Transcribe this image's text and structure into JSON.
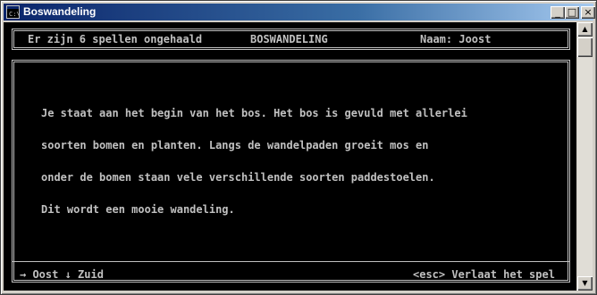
{
  "window": {
    "title": "Boswandeling",
    "controls": {
      "minimize": "_",
      "maximize": "□",
      "close": "×"
    }
  },
  "header": {
    "games_fetched": "Er zijn 6 spellen ongehaald",
    "game_title": "BOSWANDELING",
    "player_name": "Naam: Joost"
  },
  "story": {
    "lines": [
      "Je staat aan het begin van het bos. Het bos is gevuld met allerlei",
      "soorten bomen en planten. Langs de wandelpaden groeit mos en",
      "onder de bomen staan vele verschillende soorten paddestoelen.",
      "Dit wordt een mooie wandeling."
    ]
  },
  "footer": {
    "directions": "→ Oost ↓ Zuid",
    "quit_hint": "<esc> Verlaat het spel"
  },
  "scrollbar": {
    "up": "▲",
    "down": "▼"
  }
}
